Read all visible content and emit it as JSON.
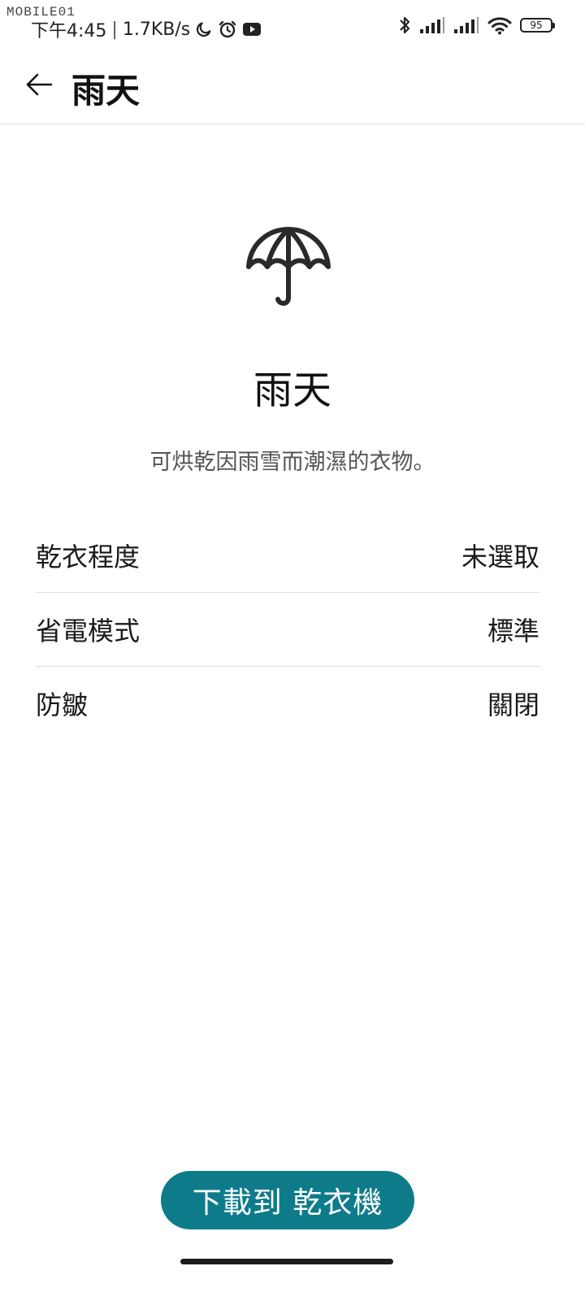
{
  "status_bar": {
    "watermark": "MOBILE01",
    "time": "下午4:45",
    "speed": "1.7KB/s",
    "battery": "95"
  },
  "app_bar": {
    "title": "雨天"
  },
  "hero": {
    "title": "雨天",
    "description": "可烘乾因雨雪而潮濕的衣物。",
    "icon": "umbrella-icon"
  },
  "settings": [
    {
      "label": "乾衣程度",
      "value": "未選取"
    },
    {
      "label": "省電模式",
      "value": "標準"
    },
    {
      "label": "防皺",
      "value": "關閉"
    }
  ],
  "primary_button": {
    "label": "下載到 乾衣機"
  },
  "colors": {
    "accent": "#0e7b8b",
    "text": "#1c1c1c",
    "muted": "#555555"
  }
}
